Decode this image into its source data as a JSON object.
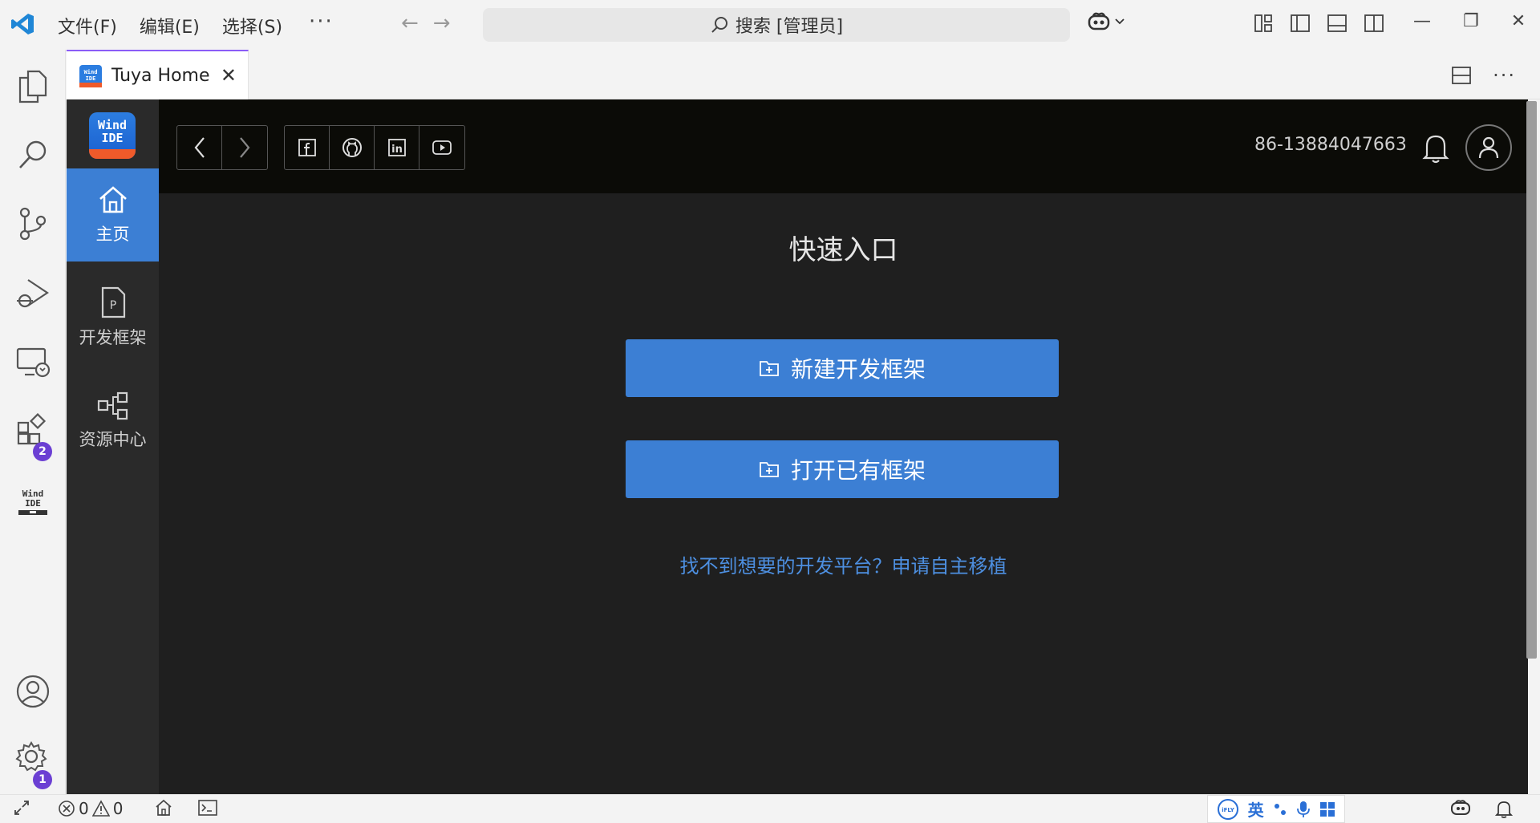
{
  "menu": {
    "file": "文件(F)",
    "edit": "编辑(E)",
    "select": "选择(S)",
    "more": "···"
  },
  "search": {
    "text": "搜索 [管理员]"
  },
  "tab": {
    "label": "Tuya Home",
    "close": "✕",
    "more": "···"
  },
  "activity": {
    "extensions_badge": "2",
    "settings_badge": "1"
  },
  "sidenav": {
    "logo_text_1": "Wind",
    "logo_text_2": "IDE",
    "items": [
      {
        "label": "主页"
      },
      {
        "label": "开发框架"
      },
      {
        "label": "资源中心"
      }
    ]
  },
  "header": {
    "phone": "86-13884047663"
  },
  "main": {
    "title": "快速入口",
    "new_framework": "新建开发框架",
    "open_framework": "打开已有框架",
    "link": "找不到想要的开发平台？申请自主移植"
  },
  "status": {
    "errors": "0",
    "warnings": "0",
    "ime_lang": "英"
  },
  "colors": {
    "accent": "#3c7fd4",
    "link": "#4d8fe0",
    "badge": "#6b3fd3"
  }
}
